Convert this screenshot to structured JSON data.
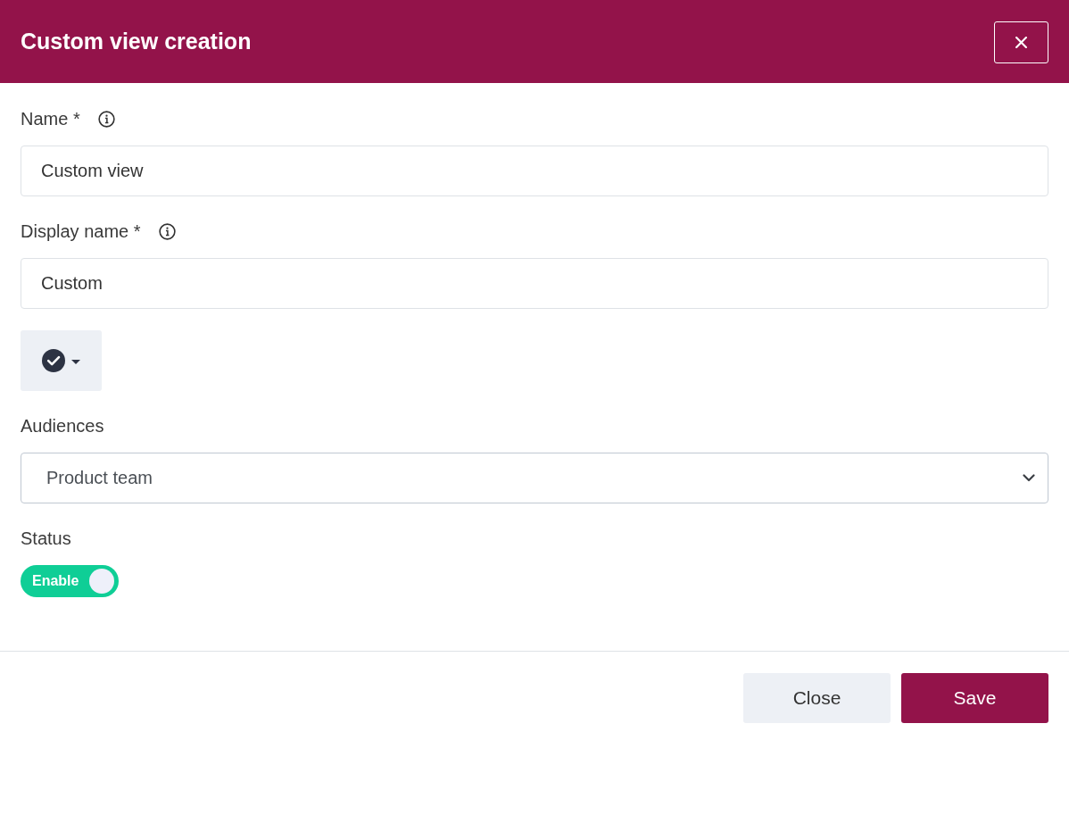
{
  "dialog": {
    "title": "Custom view creation"
  },
  "fields": [
    {
      "kind": "text",
      "label": "Name *",
      "info": true,
      "value": "Custom view"
    },
    {
      "kind": "text",
      "label": "Display name *",
      "info": true,
      "value": "Custom"
    },
    {
      "kind": "icon_picker"
    },
    {
      "kind": "select",
      "label": "Audiences",
      "value": "Product team"
    },
    {
      "kind": "toggle",
      "label": "Status",
      "on": true,
      "toggle_label": "Enable"
    }
  ],
  "buttons": [
    {
      "label": "Close",
      "kind": "secondary"
    },
    {
      "label": "Save",
      "kind": "primary"
    }
  ]
}
